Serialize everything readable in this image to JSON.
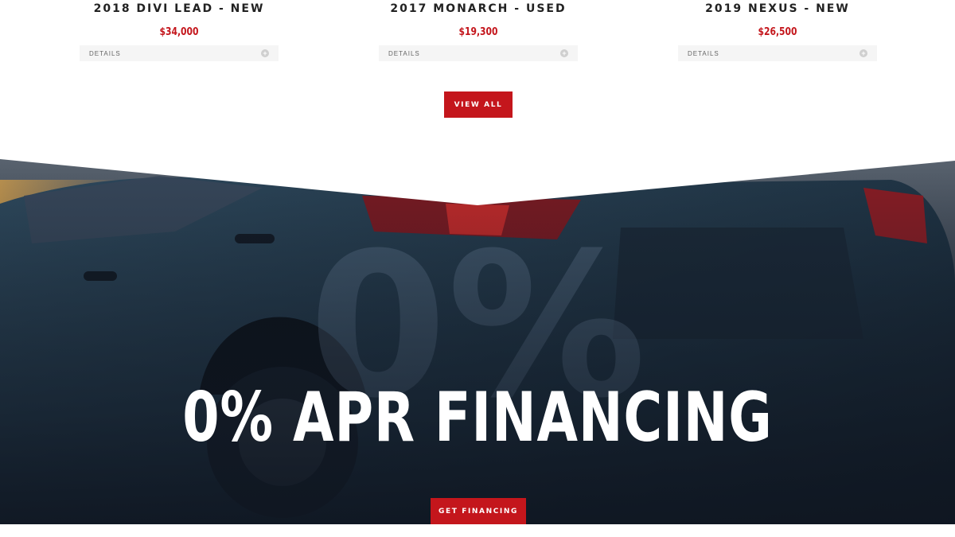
{
  "listings": [
    {
      "title": "2018 DIVI LEAD - NEW",
      "price": "$34,000",
      "details_label": "DETAILS"
    },
    {
      "title": "2017 MONARCH - USED",
      "price": "$19,300",
      "details_label": "DETAILS"
    },
    {
      "title": "2019 NEXUS - NEW",
      "price": "$26,500",
      "details_label": "DETAILS"
    }
  ],
  "view_all_label": "VIEW ALL",
  "hero": {
    "background_text": "0%",
    "title": "0% APR FINANCING",
    "cta_label": "GET FINANCING"
  },
  "colors": {
    "accent": "#c4161c",
    "heading": "#222222",
    "details_bg": "#f5f5f5",
    "hero_overlay": "#1f2a38"
  }
}
